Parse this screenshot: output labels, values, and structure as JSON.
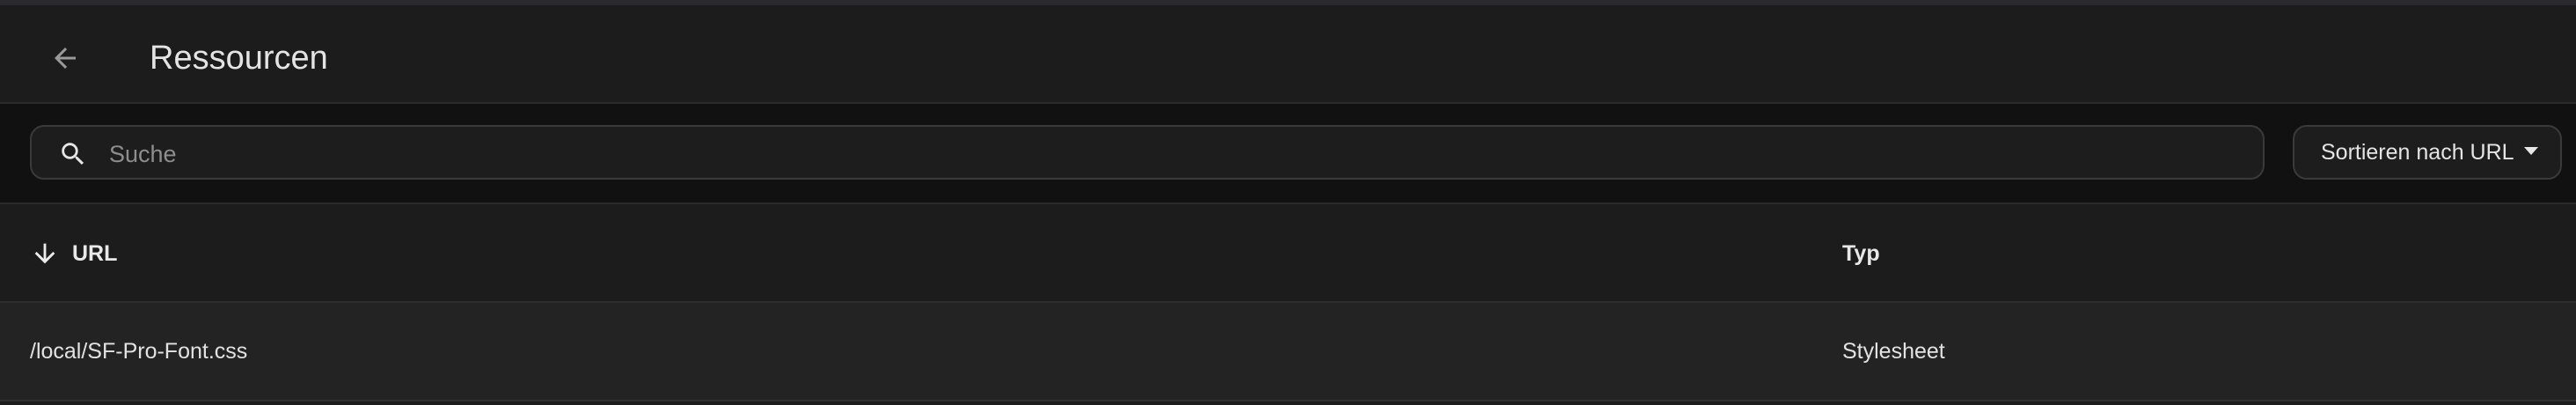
{
  "header": {
    "title": "Ressourcen",
    "back_icon": "arrow-left-icon"
  },
  "toolbar": {
    "search_placeholder": "Suche",
    "search_value": "",
    "search_icon": "magnifier-icon",
    "sort_label": "Sortieren nach URL",
    "sort_caret_icon": "caret-down-icon"
  },
  "table": {
    "sort_icon": "arrow-down-icon",
    "columns": [
      {
        "label": "URL"
      },
      {
        "label": "Typ"
      }
    ],
    "rows": [
      {
        "url": "/local/SF-Pro-Font.css",
        "type": "Stylesheet"
      }
    ]
  },
  "colors": {
    "header_bg": "#1c1c1c",
    "page_bg": "#111111",
    "row_bg": "#232323",
    "text": "#e4e4e4",
    "muted_text": "#8d8d8d"
  }
}
